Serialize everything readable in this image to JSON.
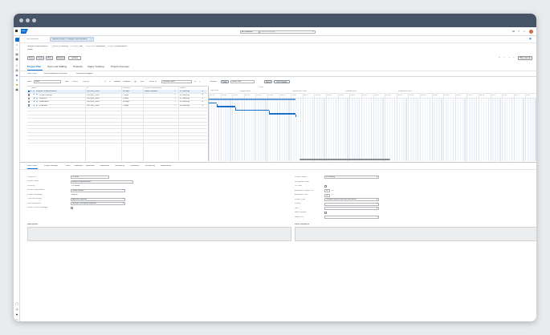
{
  "shell": {
    "logo": "SAP",
    "scope": "All Categories",
    "search_placeholder": "Search Everything"
  },
  "nav": {
    "back_label": "Not published",
    "tab_title": "Ballcast Project - Analyse Implementation"
  },
  "header": {
    "title_line1": "Analyse Implementation",
    "title_line2": "(Draft)",
    "status_label": "Status:",
    "status_value": "In Planning",
    "wbs_label": "% Comp. Phs:",
    "wbs_value": "0%",
    "tracks_label": "Proj. Cust.:",
    "tracks_value": "Standalone",
    "type_label": "Project type:",
    "type_value": "Standalone",
    "actions": [
      "Save",
      "Create",
      "More",
      "Release",
      "Actions"
    ],
    "right_btn": "Hide side bar"
  },
  "tabs": {
    "main": [
      "Project Plan",
      "Team and Staffing",
      "Products",
      "Status Tracking",
      "Project Overview"
    ],
    "sub": [
      "Basic Attrib.",
      "Work Breakdown Structure",
      "Document Diagram"
    ]
  },
  "toolbar": {
    "view_label": "View:",
    "view_value": "Basic",
    "items": [
      "Add",
      "Delete",
      "Display",
      "Expand",
      "Collapse",
      "Link",
      "Scroll To"
    ],
    "select_value": "Duration Dates",
    "right_items": [
      "Timeline",
      "Today",
      "Month View",
      "Week",
      "Print Details"
    ]
  },
  "table": {
    "columns": [
      "Name",
      "ID",
      "Duration",
      "Person Responsible",
      "Status"
    ],
    "rows": [
      {
        "name": "Analyse Implementation",
        "id": "CPP030_5588",
        "duration": "38 days",
        "person": "Walter Melanie",
        "status": "In Planning"
      },
      {
        "name": "Project Startup",
        "id": "CPP030_5586",
        "duration": "5 days",
        "person": "",
        "status": "In Planning"
      },
      {
        "name": "Analysis",
        "id": "CPP030_5589",
        "duration": "8 days",
        "person": "",
        "status": "In Planning"
      },
      {
        "name": "Realization",
        "id": "CPP030_5590",
        "duration": "10 days",
        "person": "",
        "status": "In Planning"
      },
      {
        "name": "Final test",
        "id": "CPP030_5591",
        "duration": "5 days",
        "person": "",
        "status": "In Planning"
      }
    ]
  },
  "gantt": {
    "year": "2023",
    "months": [
      "July 2023",
      "August 2023",
      "September 2023",
      "October 2023",
      "November 2023"
    ],
    "weeks": [
      "CW 29",
      "CW 30",
      "CW 31",
      "CW 32",
      "CW 33",
      "CW 34",
      "CW 35",
      "CW 36",
      "CW 37",
      "CW 38",
      "CW 39",
      "CW 40",
      "CW 41",
      "CW 42",
      "CW 43",
      "CW 44",
      "CW 45",
      "CW 46",
      "CW 47",
      "CW 48",
      "CW 49",
      "CW 50",
      "CW 51",
      "CW 52",
      "CW 1",
      "CW 2",
      "CW 3",
      "CW 4"
    ]
  },
  "detail_tabs": [
    "Basic Data",
    "Project Settings",
    "Work",
    "Materials",
    "Expenses",
    "Resources",
    "Scheduling",
    "Checklists",
    "Accounting",
    "Attachments"
  ],
  "detail": {
    "left": [
      {
        "label": "Project ID *",
        "value": "CPP030"
      },
      {
        "label": "Project Name *",
        "value": "Analyse Implementation"
      },
      {
        "label": "Currency",
        "value": "US Dollar"
      },
      {
        "label": "Person Responsible *",
        "value": "Walter Melanie"
      },
      {
        "label": "Project Language",
        "value": "English"
      },
      {
        "label": "Time Accounting",
        "value": "Approval Required"
      },
      {
        "label": "Sold Operations",
        "value": "No Work Description Required"
      },
      {
        "label": "Confirm Work Packages",
        "value": ""
      }
    ],
    "right": [
      {
        "label": "Project Status *",
        "value": "In Planning"
      },
      {
        "label": "Completion Date",
        "value": ""
      },
      {
        "label": "On Hold",
        "value": ""
      },
      {
        "label": "Estimated Project Hrs",
        "value": "0h"
      },
      {
        "label": "Estimated Cost",
        "value": "0h"
      },
      {
        "label": "Project Type *",
        "value": "Customer project with other allocations"
      },
      {
        "label": "Priority",
        "value": ""
      },
      {
        "label": "Site",
        "value": ""
      },
      {
        "label": "Alert Indicator",
        "value": ""
      },
      {
        "label": "Sales Unit",
        "value": ""
      }
    ],
    "description_label": "Description",
    "comment_label": "Risk Comments"
  }
}
